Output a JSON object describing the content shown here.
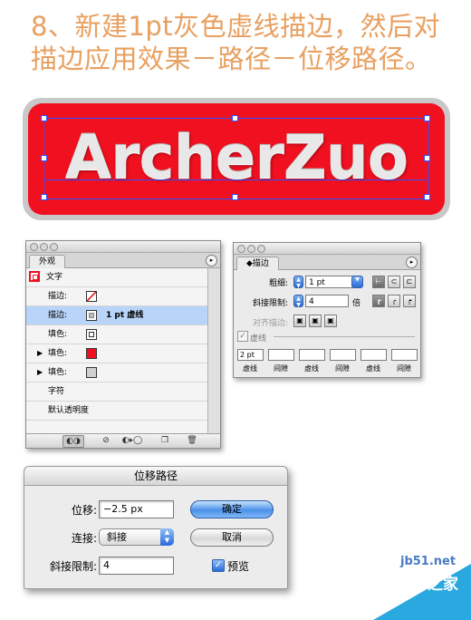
{
  "heading": {
    "line1": "8、新建1pt灰色虚线描边，然后对",
    "line2": "描边应用效果－路径－位移路径。"
  },
  "banner": {
    "text": "ArcherZuo"
  },
  "appearance_panel": {
    "tab": "外观",
    "rows": [
      {
        "label": "文字"
      },
      {
        "label": "描边:"
      },
      {
        "label": "描边:",
        "value": "1 pt 虚线"
      },
      {
        "label": "填色:"
      },
      {
        "label": "填色:"
      },
      {
        "label": "填色:"
      },
      {
        "label": "字符"
      },
      {
        "label": "默认透明度"
      }
    ]
  },
  "stroke_panel": {
    "tab": "描边",
    "weight_label": "粗细:",
    "weight_value": "1 pt",
    "miter_label": "斜接限制:",
    "miter_value": "4",
    "miter_unit": "倍",
    "align_label": "对齐描边:",
    "dashed_label": "虚线",
    "dash_first": "2 pt",
    "dash_labels": [
      "虚线",
      "间隙",
      "虚线",
      "间隙",
      "虚线",
      "间隙"
    ]
  },
  "offset_dialog": {
    "title": "位移路径",
    "offset_label": "位移:",
    "offset_value": "−2.5 px",
    "join_label": "连接:",
    "join_value": "斜接",
    "miter_label": "斜接限制:",
    "miter_value": "4",
    "ok_label": "确定",
    "cancel_label": "取消",
    "preview_label": "预览"
  },
  "watermark": {
    "site": "jb51.net",
    "name": "脚本之家"
  },
  "colors": {
    "heading": "#e8a060",
    "banner_red": "#f01020",
    "selection": "#3050ff",
    "accent_blue": "#2a6ad8"
  }
}
